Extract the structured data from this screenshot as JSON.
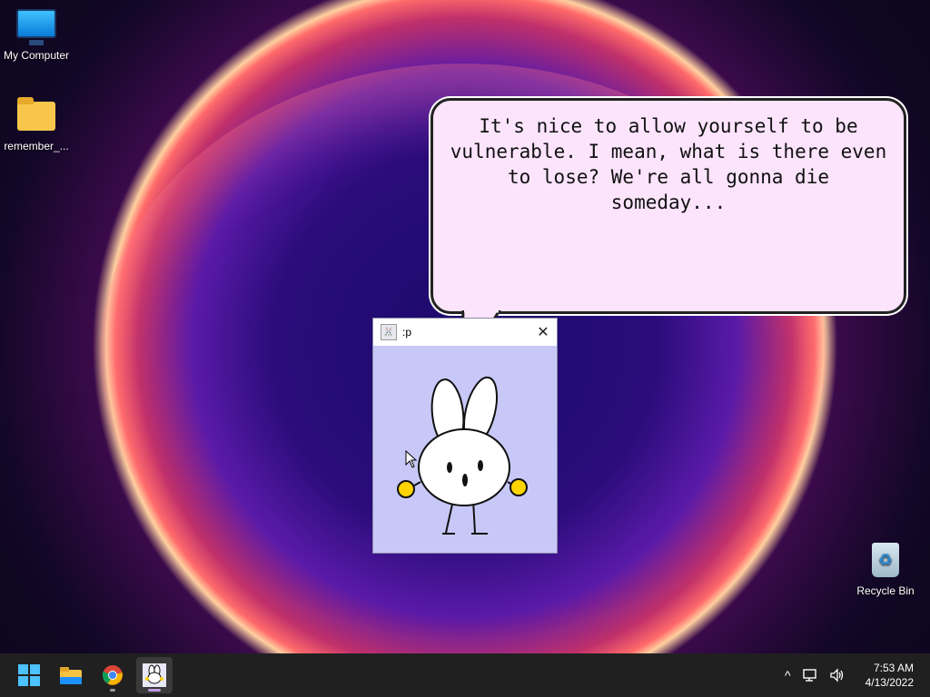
{
  "desktop": {
    "icons": [
      {
        "label": "My Computer"
      },
      {
        "label": "remember_..."
      },
      {
        "label": "Recycle Bin"
      }
    ]
  },
  "speech_bubble": {
    "text": "It's nice to allow yourself to be vulnerable. I mean, what is there even to lose? We're all gonna die someday..."
  },
  "pet_window": {
    "title": ":p",
    "close_glyph": "✕"
  },
  "taskbar": {
    "pinned": [
      "start-icon",
      "file-explorer-icon",
      "chrome-icon",
      "bunny-pet-icon"
    ]
  },
  "tray": {
    "chevron": "^",
    "time": "7:53 AM",
    "date": "4/13/2022"
  },
  "colors": {
    "bubble_bg": "#fce4fc",
    "window_bg": "#c8c8f8",
    "taskbar_bg": "#202020",
    "accent": "#4cc2ff"
  }
}
